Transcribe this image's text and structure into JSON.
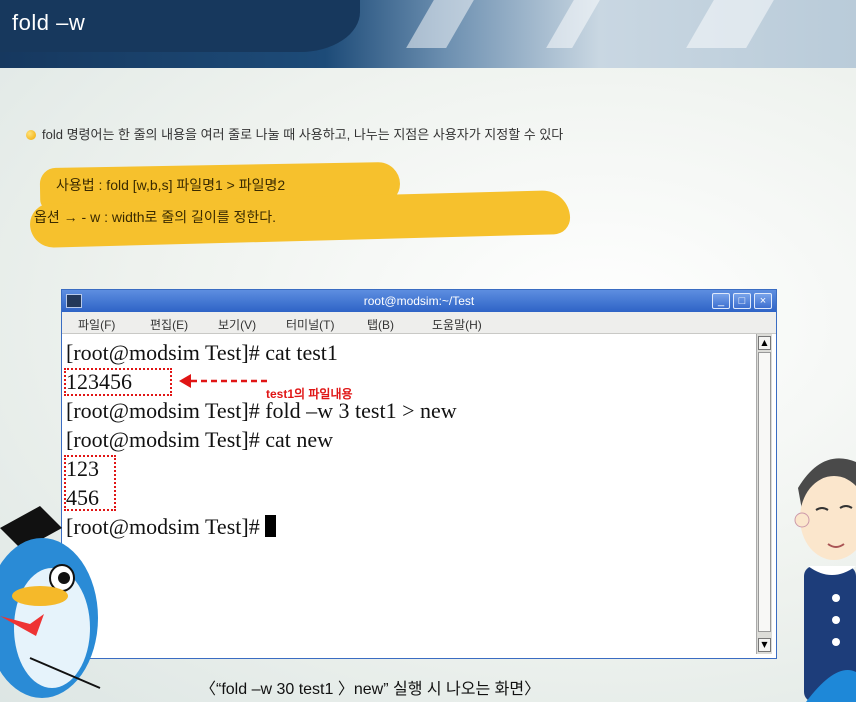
{
  "slide": {
    "title": "fold –w",
    "description": "fold 명령어는 한 줄의 내용을 여러 줄로 나눌 때 사용하고, 나누는 지점은 사용자가 지정할 수 있다",
    "usage_line": "사용법 : fold [w,b,s] 파일명1 > 파일명2",
    "option_line": "옵션 → - w : width로 줄의 길이를 정한다.",
    "caption": "〈“fold –w 30 test1 〉new” 실행 시 나오는 화면〉"
  },
  "terminal": {
    "window_title": "root@modsim:~/Test",
    "menu": [
      "파일(F)",
      "편집(E)",
      "보기(V)",
      "터미널(T)",
      "탭(B)",
      "도움말(H)"
    ],
    "lines": [
      "[root@modsim Test]# cat test1",
      "123456",
      "[root@modsim Test]# fold –w 3 test1 > new",
      "[root@modsim Test]# cat new",
      "123",
      "456",
      "[root@modsim Test]# "
    ],
    "annotation": "test1의 파일내용",
    "buttons": {
      "minimize": "_",
      "maximize": "□",
      "close": "×"
    }
  },
  "colors": {
    "highlight": "#f6c12d",
    "annotation_red": "#e01515",
    "titlebar_blue": "#2e63c6",
    "banner_navy": "#17385d"
  }
}
